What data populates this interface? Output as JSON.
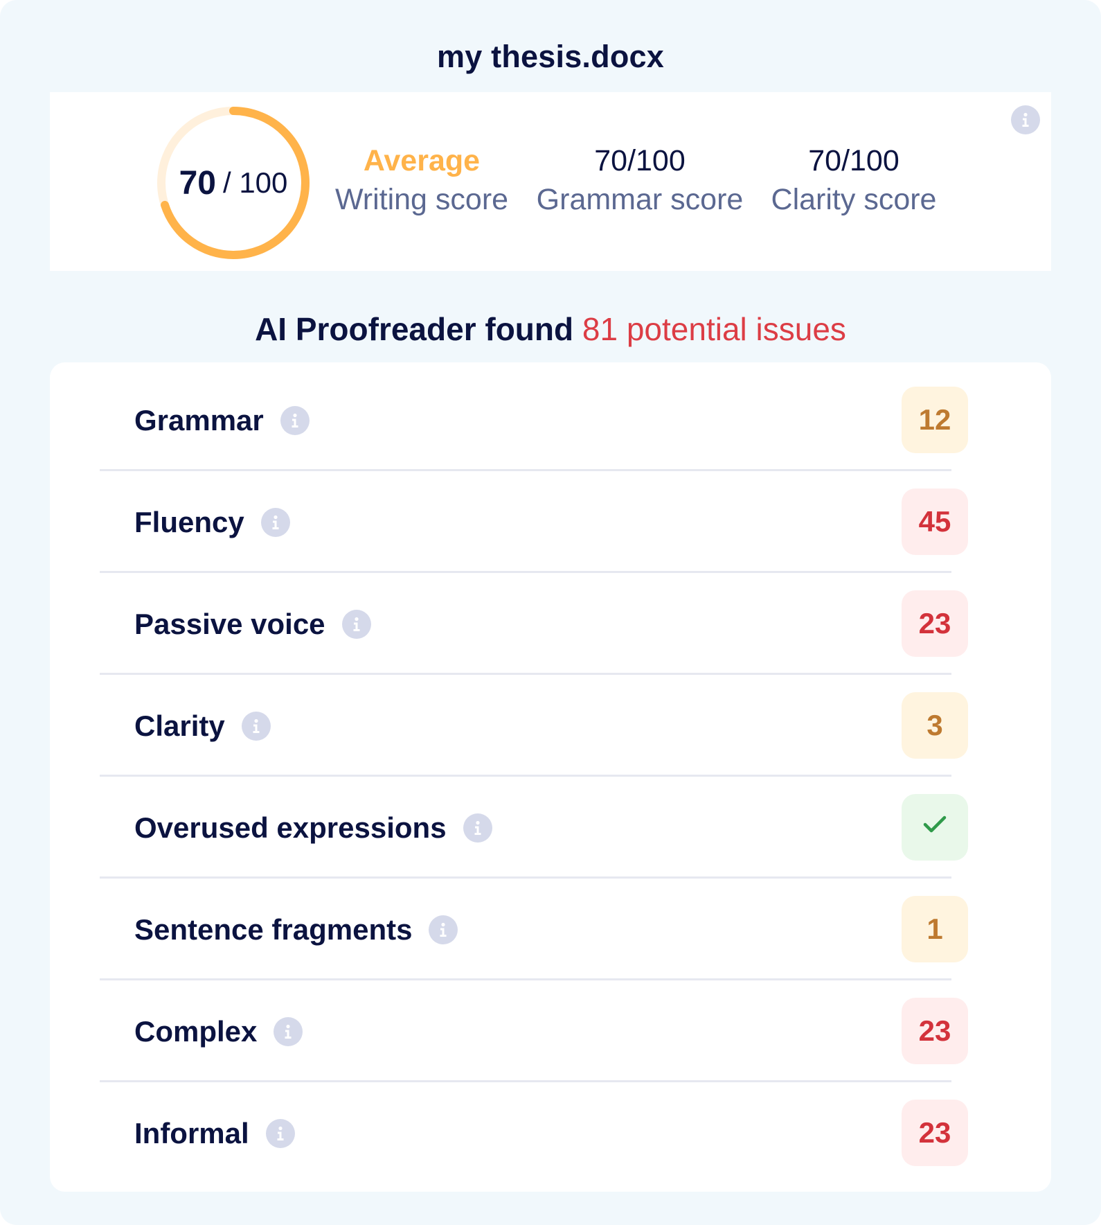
{
  "document": {
    "title": "my thesis.docx"
  },
  "scores": {
    "overall": {
      "value": "70",
      "separator": "/ 100",
      "fraction": 0.7
    },
    "writing": {
      "rating": "Average",
      "label": "Writing score"
    },
    "grammar": {
      "value": "70/100",
      "label": "Grammar score"
    },
    "clarity": {
      "value": "70/100",
      "label": "Clarity score"
    },
    "info_icon": "info-icon"
  },
  "summary": {
    "prefix": "AI Proofreader found",
    "count": "81",
    "suffix": "potential issues"
  },
  "issues": [
    {
      "label": "Grammar",
      "count": "12",
      "severity": "warn"
    },
    {
      "label": "Fluency",
      "count": "45",
      "severity": "bad"
    },
    {
      "label": "Passive voice",
      "count": "23",
      "severity": "bad"
    },
    {
      "label": "Clarity",
      "count": "3",
      "severity": "warn"
    },
    {
      "label": "Overused expressions",
      "count": "",
      "severity": "ok",
      "icon": "check-icon"
    },
    {
      "label": "Sentence fragments",
      "count": "1",
      "severity": "warn"
    },
    {
      "label": "Complex",
      "count": "23",
      "severity": "bad"
    },
    {
      "label": "Informal",
      "count": "23",
      "severity": "bad"
    }
  ],
  "colors": {
    "ring": "#ffb34a",
    "ring_track": "#fff0dc",
    "accent_red": "#dc3d45",
    "warn_text": "#be7a30",
    "bad_text": "#d3323b",
    "ok_text": "#2f9a4a"
  }
}
